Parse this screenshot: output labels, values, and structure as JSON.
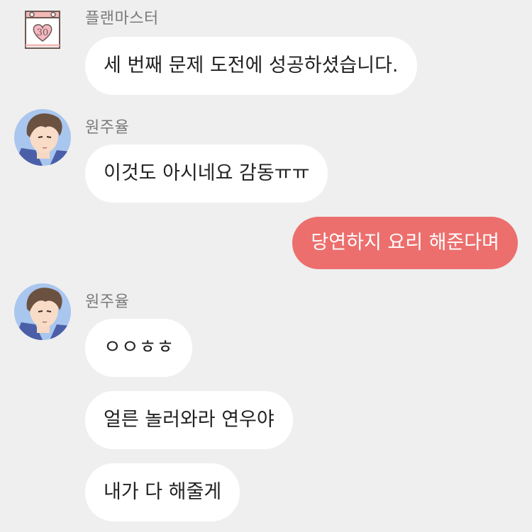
{
  "colors": {
    "background": "#efefef",
    "incoming_bubble": "#ffffff",
    "outgoing_bubble": "#ec6f6d",
    "sender_name": "#7a7a7a"
  },
  "messages": [
    {
      "sender": "플랜마스터",
      "avatar": "calendar-heart-icon",
      "calendar_number": "30",
      "text": "세 번째 문제 도전에 성공하셨습니다."
    },
    {
      "sender": "원주율",
      "avatar": "avatar-boy",
      "text": "이것도 아시네요 감동ㅠㅠ"
    },
    {
      "sender": "",
      "text": "당연하지 요리 해준다며"
    },
    {
      "sender": "원주율",
      "avatar": "avatar-boy",
      "texts": [
        "ㅇㅇㅎㅎ",
        "얼른 놀러와라 연우야",
        "내가 다 해줄게"
      ]
    }
  ]
}
